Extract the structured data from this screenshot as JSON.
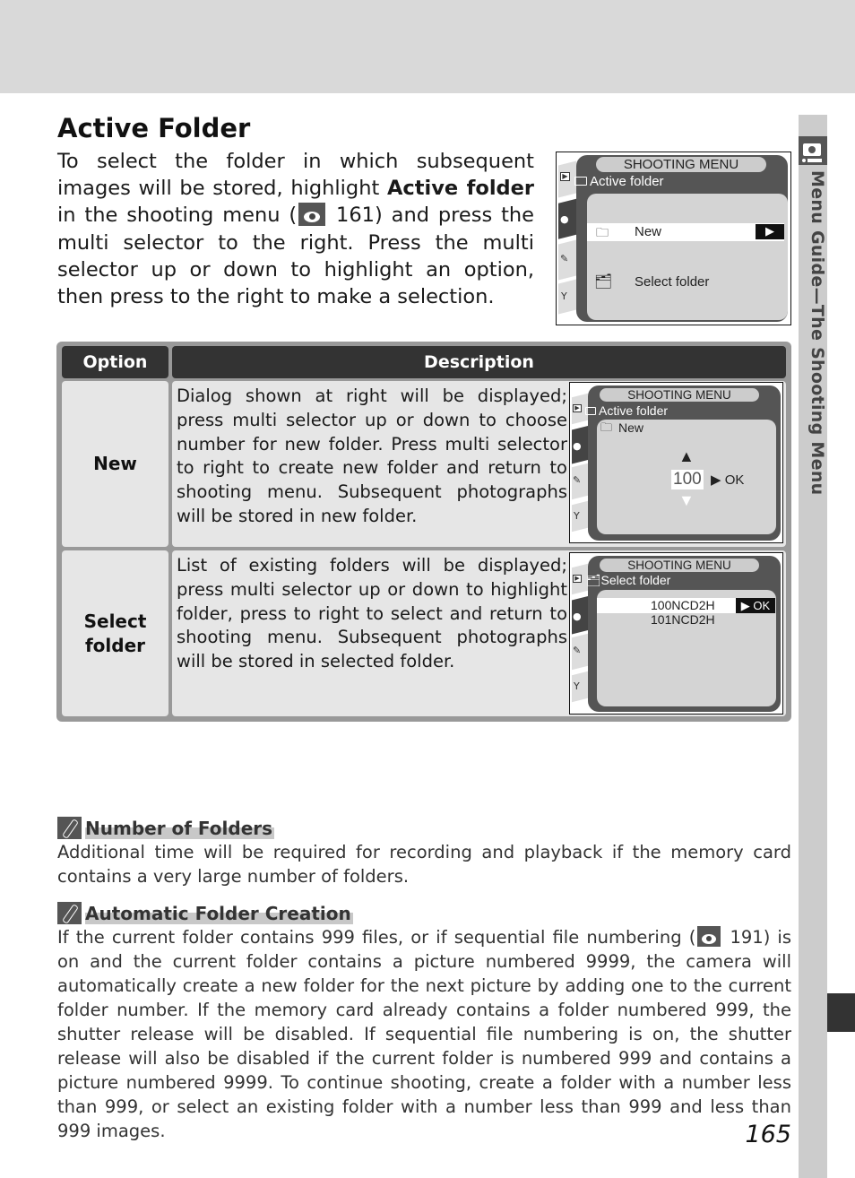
{
  "page": {
    "title": "Active Folder",
    "page_number": "165",
    "side_tab": {
      "label": "Menu Guide—The Shooting Menu",
      "icon": "camera-icon"
    }
  },
  "intro": {
    "part1": "To select the folder in which subsequent images will be stored, highlight ",
    "bold": "Active folder",
    "part2": " in the shooting menu (",
    "ref_icon": "eye-reference-icon",
    "ref_page": "161",
    "part3": ") and press the multi selector to the right.  Press the multi selector up or down to highlight an option, then press to the right to make a selection."
  },
  "screen_main": {
    "header": "SHOOTING MENU",
    "subtitle": "Active folder",
    "items": [
      {
        "label": "New",
        "icon": "new-folder-icon",
        "selected": true,
        "action": "▶"
      },
      {
        "label": "Select folder",
        "icon": "folders-icon",
        "selected": false
      }
    ],
    "side_tabs": [
      "playback-icon",
      "camera-icon",
      "pencil-icon",
      "wrench-icon"
    ]
  },
  "table": {
    "headers": {
      "option": "Option",
      "description": "Description"
    },
    "rows": [
      {
        "option": "New",
        "description": "Dialog shown at right will be displayed; press multi selector up or down to choose number for new folder.  Press multi selector to right to create new folder and return to shooting menu.  Subsequent photographs will be stored in new folder.",
        "screen": {
          "header": "SHOOTING MENU",
          "subtitle": "Active folder",
          "item": "New",
          "up_arrow": "▲",
          "value": "100",
          "down_arrow": "▼",
          "ok": "▶ OK"
        }
      },
      {
        "option": "Select folder",
        "description": "List of existing folders will be displayed; press multi selector up or down to highlight folder, press to right to select and return to shooting menu.  Subsequent photographs will be stored in selected folder.",
        "screen": {
          "header": "SHOOTING MENU",
          "subtitle": "Select folder",
          "folders": [
            "100NCD2H",
            "101NCD2H"
          ],
          "ok": "▶ OK"
        }
      }
    ]
  },
  "notes": [
    {
      "icon": "pencil-note-icon",
      "title": "Number of Folders",
      "body": "Additional time will be required for recording and playback if the memory card contains a very large number of folders."
    },
    {
      "icon": "pencil-note-icon",
      "title": "Automatic Folder Creation",
      "body_part1": "If the current folder contains 999 files, or if sequential file numbering (",
      "ref_page": "191",
      "body_part2": ") is on and the current folder contains a picture numbered 9999, the camera will automatically create a new folder for the next picture by adding one to the current folder number.  If the memory card already contains a folder numbered 999, the shutter release will be disabled.  If sequential file numbering is on, the shutter release will also be disabled if the current folder is numbered 999 and contains a picture numbered 9999.  To continue shooting, create a folder with a number less than 999, or select an existing folder with a number less than 999 and less than 999 images."
    }
  ]
}
